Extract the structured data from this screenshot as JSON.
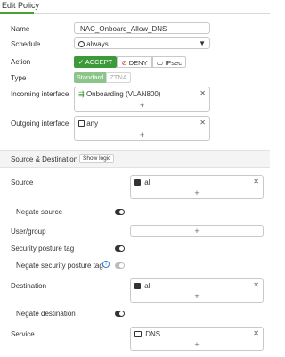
{
  "page": {
    "title": "Edit Policy"
  },
  "form": {
    "name": {
      "label": "Name",
      "value": "NAC_Onboard_Allow_DNS"
    },
    "schedule": {
      "label": "Schedule",
      "value": "always"
    },
    "action": {
      "label": "Action",
      "options": [
        "ACCEPT",
        "DENY",
        "IPsec"
      ],
      "selected": "ACCEPT"
    },
    "type": {
      "label": "Type",
      "options": [
        "Standard",
        "ZTNA"
      ],
      "selected": "Standard"
    },
    "incoming_interface": {
      "label": "Incoming interface",
      "items": [
        "Onboarding (VLAN800)"
      ]
    },
    "outgoing_interface": {
      "label": "Outgoing interface",
      "items": [
        "any"
      ]
    }
  },
  "source_destination": {
    "section_title": "Source & Destination",
    "show_logic_label": "Show logic",
    "source": {
      "label": "Source",
      "items": [
        "all"
      ]
    },
    "negate_source": {
      "label": "Negate source",
      "enabled": false
    },
    "user_group": {
      "label": "User/group"
    },
    "security_posture_tag": {
      "label": "Security posture tag",
      "enabled": false
    },
    "negate_security_posture_tag": {
      "label": "Negate security posture tag",
      "enabled": false
    },
    "destination": {
      "label": "Destination",
      "items": [
        "all"
      ]
    },
    "negate_destination": {
      "label": "Negate destination",
      "enabled": false
    },
    "service": {
      "label": "Service",
      "items": [
        "DNS"
      ]
    }
  },
  "colors": {
    "accent_green": "#3d9a3a",
    "tab_underline": "#49a32f",
    "info_blue": "#3a7bd5"
  }
}
